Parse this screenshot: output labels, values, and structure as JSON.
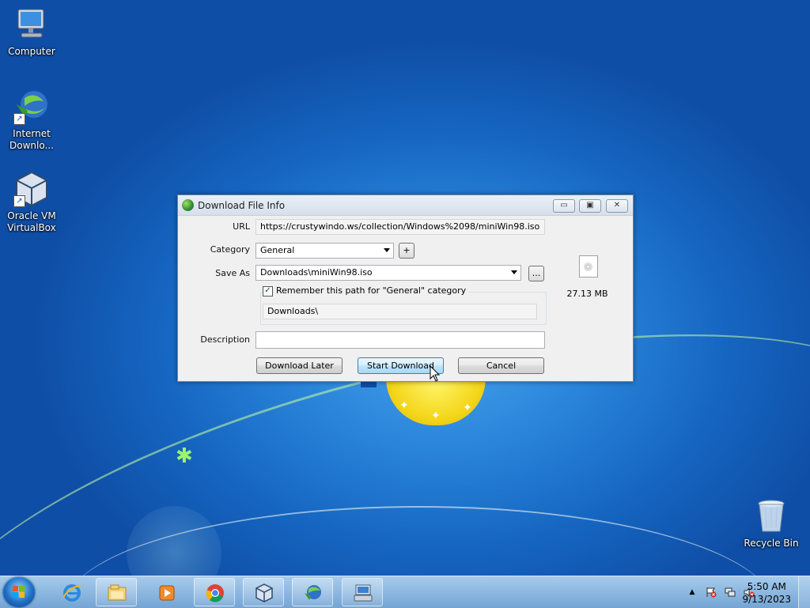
{
  "desktop": {
    "icons": [
      {
        "label": "Computer"
      },
      {
        "label": "Internet Downlo..."
      },
      {
        "label": "Oracle VM VirtualBox"
      },
      {
        "label": "Recycle Bin"
      }
    ]
  },
  "dialog": {
    "title": "Download File Info",
    "controls": {
      "minimize": "▭",
      "maximize": "▣",
      "close": "✕"
    },
    "url_label": "URL",
    "url_value": "https://crustywindo.ws/collection/Windows%2098/miniWin98.iso",
    "category_label": "Category",
    "category_value": "General",
    "add_category": "+",
    "save_as_label": "Save As",
    "save_as_value": "Downloads\\miniWin98.iso",
    "browse": "...",
    "remember_checked": true,
    "remember_label": "Remember this path for \"General\" category",
    "remember_check_glyph": "✓",
    "remembered_path": "Downloads\\",
    "description_label": "Description",
    "description_value": "",
    "file_size": "27.13  MB",
    "buttons": {
      "download_later": "Download Later",
      "start_download": "Start Download",
      "cancel": "Cancel"
    }
  },
  "taskbar": {
    "pinned": [
      {
        "icon": "internet-explorer-icon"
      },
      {
        "icon": "file-explorer-icon"
      },
      {
        "icon": "media-player-icon"
      },
      {
        "icon": "chrome-icon"
      },
      {
        "icon": "virtualbox-icon"
      },
      {
        "icon": "internet-download-manager-icon"
      },
      {
        "icon": "keyboard-app-icon"
      }
    ],
    "tray": {
      "expand": "▲",
      "time": "5:50 AM",
      "date": "9/13/2023"
    }
  },
  "colors": {
    "desktop_blue": "#1565c0",
    "default_button_border": "#3c7fb1",
    "taskbar": "#8bb8e0"
  }
}
